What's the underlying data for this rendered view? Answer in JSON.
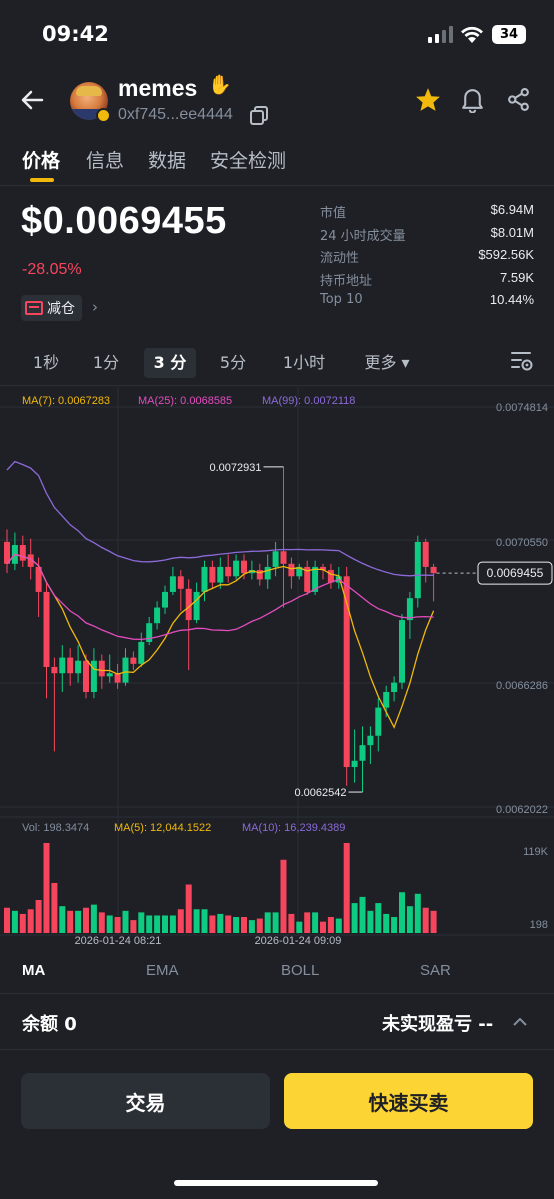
{
  "status_bar": {
    "time": "09:42",
    "battery": "34"
  },
  "header": {
    "token_name": "memes",
    "address": "0xf745...ee4444",
    "icons": [
      "back-arrow-icon",
      "copy-icon",
      "star-icon",
      "bell-icon",
      "share-icon"
    ]
  },
  "tabs": [
    {
      "label": "价格",
      "active": true
    },
    {
      "label": "信息",
      "active": false
    },
    {
      "label": "数据",
      "active": false
    },
    {
      "label": "安全检测",
      "active": false
    }
  ],
  "price": {
    "value": "$0.0069455",
    "change": "-28.05%",
    "reduce_label": "减仓"
  },
  "stats": [
    {
      "label": "市值",
      "value": "$6.94M"
    },
    {
      "label": "24 小时成交量",
      "value": "$8.01M"
    },
    {
      "label": "流动性",
      "value": "$592.56K"
    },
    {
      "label": "持币地址",
      "value": "7.59K"
    },
    {
      "label": "Top 10",
      "value": "10.44%"
    }
  ],
  "intervals": [
    {
      "label": "1秒",
      "active": false
    },
    {
      "label": "1分",
      "active": false
    },
    {
      "label": "3 分",
      "active": true
    },
    {
      "label": "5分",
      "active": false
    },
    {
      "label": "1小时",
      "active": false
    },
    {
      "label": "更多 ▾",
      "active": false
    }
  ],
  "colors": {
    "up": "#0ecb81",
    "down": "#f6465d",
    "ma7": "#f0b90b",
    "ma25": "#e34cbf",
    "ma99": "#8c6ad8",
    "accent": "#fcd535",
    "background": "#1e2026"
  },
  "chart_data": {
    "type": "candlestick",
    "ma_legend": {
      "ma7": "MA(7): 0.0067283",
      "ma25": "MA(25): 0.0068585",
      "ma99": "MA(99): 0.0072118"
    },
    "y_ticks": [
      "0.0074814",
      "0.0070550",
      "0.0066286",
      "0.0062022"
    ],
    "ylim": [
      0.0062022,
      0.0074814
    ],
    "current_price_label": "0.0069455",
    "high_label": "0.0072931",
    "low_label": "0.0062542",
    "x_labels": [
      "2026-01-24 08:21",
      "2026-01-24 09:09"
    ],
    "candles": [
      [
        0.00705,
        0.00698,
        0.00709,
        0.00695
      ],
      [
        0.00698,
        0.00704,
        0.00708,
        0.00696
      ],
      [
        0.00704,
        0.00699,
        0.00707,
        0.00697
      ],
      [
        0.00701,
        0.00697,
        0.00706,
        0.00693
      ],
      [
        0.00697,
        0.00689,
        0.007,
        0.00681
      ],
      [
        0.00689,
        0.00665,
        0.00692,
        0.00655
      ],
      [
        0.00665,
        0.00663,
        0.00668,
        0.00638
      ],
      [
        0.00663,
        0.00668,
        0.00672,
        0.00657
      ],
      [
        0.00668,
        0.00663,
        0.00671,
        0.00659
      ],
      [
        0.00663,
        0.00667,
        0.00672,
        0.0066
      ],
      [
        0.00667,
        0.00657,
        0.00669,
        0.00655
      ],
      [
        0.00657,
        0.00667,
        0.00671,
        0.00655
      ],
      [
        0.00667,
        0.00662,
        0.00669,
        0.00658
      ],
      [
        0.00662,
        0.00663,
        0.00669,
        0.0066
      ],
      [
        0.00663,
        0.0066,
        0.00666,
        0.00658
      ],
      [
        0.0066,
        0.00668,
        0.00671,
        0.00659
      ],
      [
        0.00668,
        0.00666,
        0.0067,
        0.00664
      ],
      [
        0.00666,
        0.00673,
        0.00676,
        0.00665
      ],
      [
        0.00673,
        0.00679,
        0.00681,
        0.00672
      ],
      [
        0.00679,
        0.00684,
        0.00686,
        0.00677
      ],
      [
        0.00684,
        0.00689,
        0.00691,
        0.00682
      ],
      [
        0.00689,
        0.00694,
        0.00697,
        0.00688
      ],
      [
        0.00694,
        0.0069,
        0.00696,
        0.00683
      ],
      [
        0.0069,
        0.0068,
        0.00693,
        0.00664
      ],
      [
        0.0068,
        0.00689,
        0.00692,
        0.00679
      ],
      [
        0.00689,
        0.00697,
        0.00699,
        0.00686
      ],
      [
        0.00697,
        0.00692,
        0.00699,
        0.0069
      ],
      [
        0.00692,
        0.00697,
        0.007,
        0.0069
      ],
      [
        0.00697,
        0.00694,
        0.00701,
        0.00692
      ],
      [
        0.00694,
        0.00699,
        0.00701,
        0.00693
      ],
      [
        0.00699,
        0.00695,
        0.00701,
        0.00693
      ],
      [
        0.00695,
        0.00696,
        0.00699,
        0.00693
      ],
      [
        0.00696,
        0.00693,
        0.00698,
        0.00691
      ],
      [
        0.00693,
        0.00697,
        0.00701,
        0.0069
      ],
      [
        0.00697,
        0.00702,
        0.00705,
        0.00694
      ],
      [
        0.00702,
        0.00698,
        0.00729,
        0.00684
      ],
      [
        0.00698,
        0.00694,
        0.007,
        0.0069
      ],
      [
        0.00694,
        0.00697,
        0.00698,
        0.00693
      ],
      [
        0.00697,
        0.00689,
        0.00699,
        0.00688
      ],
      [
        0.00689,
        0.00697,
        0.00699,
        0.00688
      ],
      [
        0.00697,
        0.00696,
        0.00698,
        0.00693
      ],
      [
        0.00696,
        0.00692,
        0.00698,
        0.0069
      ],
      [
        0.00692,
        0.00694,
        0.00697,
        0.0069
      ],
      [
        0.00694,
        0.00633,
        0.00697,
        0.00627
      ],
      [
        0.00633,
        0.00635,
        0.00645,
        0.00628
      ],
      [
        0.00635,
        0.0064,
        0.00646,
        0.00625
      ],
      [
        0.0064,
        0.00643,
        0.00646,
        0.00634
      ],
      [
        0.00643,
        0.00652,
        0.00655,
        0.00638
      ],
      [
        0.00652,
        0.00657,
        0.00659,
        0.00649
      ],
      [
        0.00657,
        0.0066,
        0.00662,
        0.00654
      ],
      [
        0.0066,
        0.0068,
        0.00682,
        0.00658
      ],
      [
        0.0068,
        0.00687,
        0.00689,
        0.00674
      ],
      [
        0.00687,
        0.00705,
        0.00707,
        0.00684
      ],
      [
        0.00705,
        0.00697,
        0.00706,
        0.00692
      ],
      [
        0.00697,
        0.00695,
        0.00698,
        0.00686
      ]
    ],
    "volume_legend": {
      "vol": "Vol: 198.3474",
      "ma5": "MA(5): 12,044.1522",
      "ma10": "MA(10): 16,239.4389"
    },
    "volume_ticks": [
      "119K",
      "198"
    ],
    "volume_max": 119000
  },
  "bottom_tabs": [
    {
      "label": "MA",
      "active": true
    },
    {
      "label": "EMA",
      "active": false
    },
    {
      "label": "BOLL",
      "active": false
    },
    {
      "label": "SAR",
      "active": false
    }
  ],
  "balance": {
    "label": "余额 0",
    "pnl_label": "未实现盈亏 --"
  },
  "actions": {
    "trade": "交易",
    "quick_trade": "快速买卖"
  }
}
